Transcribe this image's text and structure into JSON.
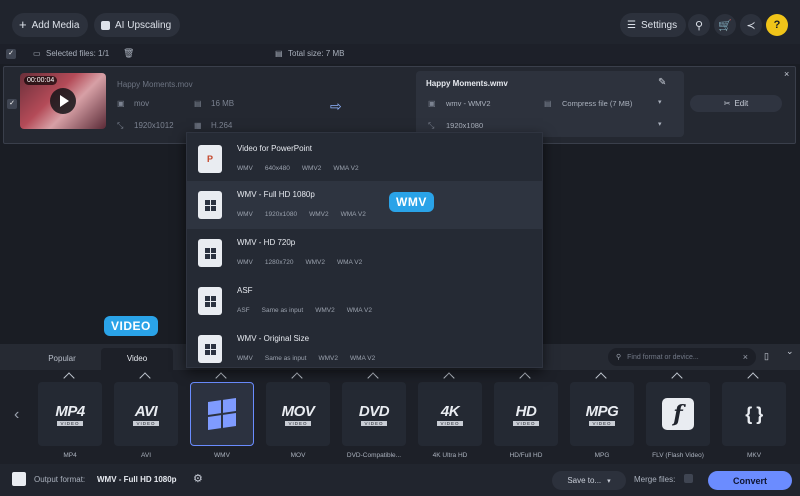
{
  "toolbar": {
    "add_media": "Add Media",
    "ai_upscaling": "AI Upscaling",
    "settings": "Settings"
  },
  "selection": {
    "selected_label": "Selected files: 1/1",
    "total_size": "Total size: 7 MB"
  },
  "file": {
    "name": "Happy Moments.mov",
    "duration": "00:00:04",
    "container": "mov",
    "size": "16 MB",
    "resolution": "1920x1012",
    "codec": "H.264"
  },
  "target": {
    "name": "Happy Moments.wmv",
    "codec": "wmv - WMV2",
    "compress": "Compress file (7 MB)",
    "resolution": "1920x1080",
    "edit_label": "Edit"
  },
  "dropdown": {
    "items": [
      {
        "title": "Video for PowerPoint",
        "specs": [
          "WMV",
          "640x480",
          "WMV2",
          "WMA V2"
        ],
        "icon": "powerpoint-icon"
      },
      {
        "title": "WMV - Full HD 1080p",
        "specs": [
          "WMV",
          "1920x1080",
          "WMV2",
          "WMA V2"
        ],
        "icon": "windows-icon"
      },
      {
        "title": "WMV - HD 720p",
        "specs": [
          "WMV",
          "1280x720",
          "WMV2",
          "WMA V2"
        ],
        "icon": "windows-icon"
      },
      {
        "title": "ASF",
        "specs": [
          "ASF",
          "Same as input",
          "WMV2",
          "WMA V2"
        ],
        "icon": "windows-icon"
      },
      {
        "title": "WMV - Original Size",
        "specs": [
          "WMV",
          "Same as input",
          "WMV2",
          "WMA V2"
        ],
        "icon": "windows-icon"
      }
    ]
  },
  "tooltips": {
    "wmv": "WMV",
    "video": "VIDEO"
  },
  "tabs": {
    "popular": "Popular",
    "video": "Video"
  },
  "search": {
    "placeholder": "Find format or device..."
  },
  "formats": [
    {
      "logo": "MP4",
      "sub": "VIDEO",
      "label": "MP4"
    },
    {
      "logo": "AVI",
      "sub": "VIDEO",
      "label": "AVI"
    },
    {
      "logo": "",
      "sub": "",
      "label": "WMV"
    },
    {
      "logo": "MOV",
      "sub": "VIDEO",
      "label": "MOV"
    },
    {
      "logo": "DVD",
      "sub": "VIDEO",
      "label": "DVD-Compatible..."
    },
    {
      "logo": "4K",
      "sub": "VIDEO",
      "label": "4K Ultra HD"
    },
    {
      "logo": "HD",
      "sub": "VIDEO",
      "label": "HD/Full HD"
    },
    {
      "logo": "MPG",
      "sub": "VIDEO",
      "label": "MPG"
    },
    {
      "logo": "f",
      "sub": "",
      "label": "FLV (Flash Video)"
    },
    {
      "logo": "{ }",
      "sub": "",
      "label": "MKV"
    }
  ],
  "footer": {
    "output_label": "Output format:",
    "output_value": "WMV - Full HD 1080p",
    "save_to": "Save to...",
    "merge_files": "Merge files:",
    "convert": "Convert"
  },
  "colors": {
    "accent": "#6b8cff",
    "tooltip": "#2aa3e8",
    "help": "#f0c419"
  }
}
